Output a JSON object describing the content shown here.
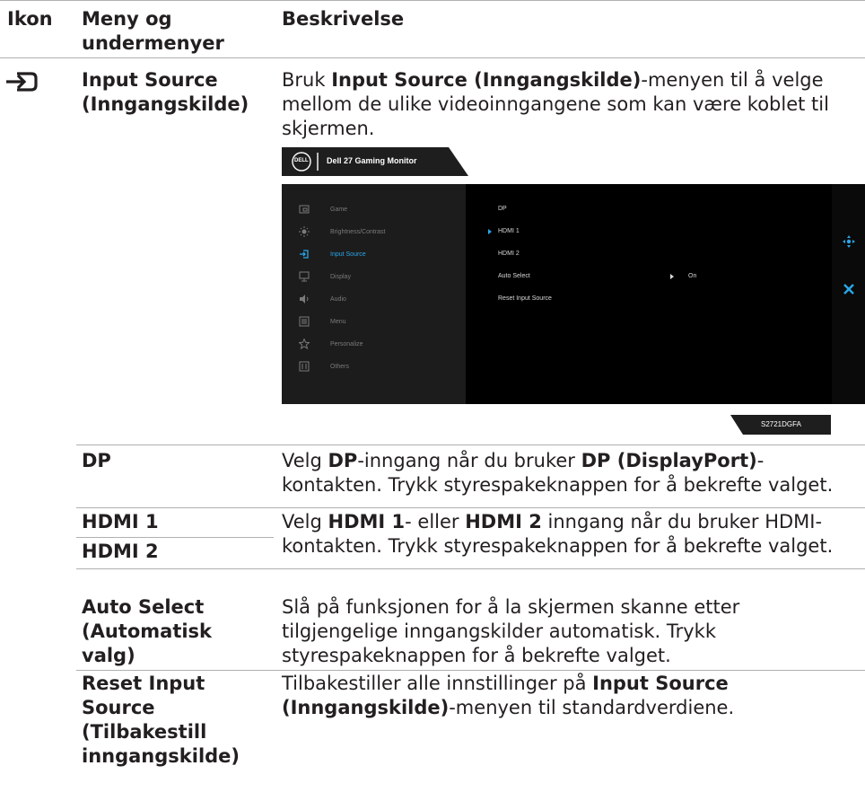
{
  "header": {
    "col_icon": "Ikon",
    "col_menu_line1": "Meny og",
    "col_menu_line2": "undermenyer",
    "col_desc": "Beskrivelse"
  },
  "main_row": {
    "icon": "input-source-icon",
    "label_line1": "Input Source",
    "label_line2": "(Inngangskilde)",
    "desc_line1_pre": "Bruk ",
    "desc_line1_bold": "Input Source (Inngangskilde)",
    "desc_line1_post": "-menyen til å velge",
    "desc_line2": "mellom de ulike videoinngangene som kan være koblet til",
    "desc_line3": "skjermen."
  },
  "osd": {
    "brand": "DELL",
    "title": "Dell 27 Gaming Monitor",
    "model": "S2721DGFA",
    "menu": [
      {
        "label": "Game",
        "icon": "game-icon"
      },
      {
        "label": "Brightness/Contrast",
        "icon": "brightness-icon"
      },
      {
        "label": "Input Source",
        "icon": "input-source-icon",
        "selected": true
      },
      {
        "label": "Display",
        "icon": "display-icon"
      },
      {
        "label": "Audio",
        "icon": "audio-icon"
      },
      {
        "label": "Menu",
        "icon": "menu-icon"
      },
      {
        "label": "Personalize",
        "icon": "star-icon"
      },
      {
        "label": "Others",
        "icon": "others-icon"
      }
    ],
    "submenu": [
      {
        "label": "DP"
      },
      {
        "label": "HDMI 1",
        "current": true
      },
      {
        "label": "HDMI 2"
      },
      {
        "label": "Auto Select",
        "value": "On"
      },
      {
        "label": "Reset Input Source"
      }
    ],
    "nav_icon": "joystick-icon",
    "close_icon": "close-icon",
    "accent": "#2aa6e8"
  },
  "rows": {
    "dp": {
      "label": "DP",
      "l1_a": "Velg ",
      "l1_b": "DP",
      "l1_c": "-inngang når du bruker ",
      "l1_d": "DP (DisplayPort)",
      "l1_e": "-",
      "l2": "kontakten. Trykk styrespakeknappen for å bekrefte valget."
    },
    "hdmi": {
      "label1": "HDMI 1",
      "label2": "HDMI 2",
      "l1_a": "Velg ",
      "l1_b": "HDMI 1",
      "l1_c": "- eller ",
      "l1_d": "HDMI 2",
      "l1_e": " inngang når du bruker HDMI-",
      "l2": "kontakten. Trykk styrespakeknappen for å bekrefte valget."
    },
    "auto": {
      "label1": "Auto Select",
      "label2": "(Automatisk",
      "label3": "valg)",
      "l1": "Slå på funksjonen for å la skjermen skanne etter",
      "l2": "tilgjengelige inngangskilder automatisk. Trykk",
      "l3": "styrespakeknappen for å bekrefte valget."
    },
    "reset": {
      "label1": "Reset Input",
      "label2": "Source",
      "label3": "(Tilbakestill",
      "label4": "inngangskilde)",
      "l1_a": "Tilbakestiller alle innstillinger på ",
      "l1_b": "Input Source",
      "l2_a": "(Inngangskilde)",
      "l2_b": "-menyen til standardverdiene."
    }
  }
}
